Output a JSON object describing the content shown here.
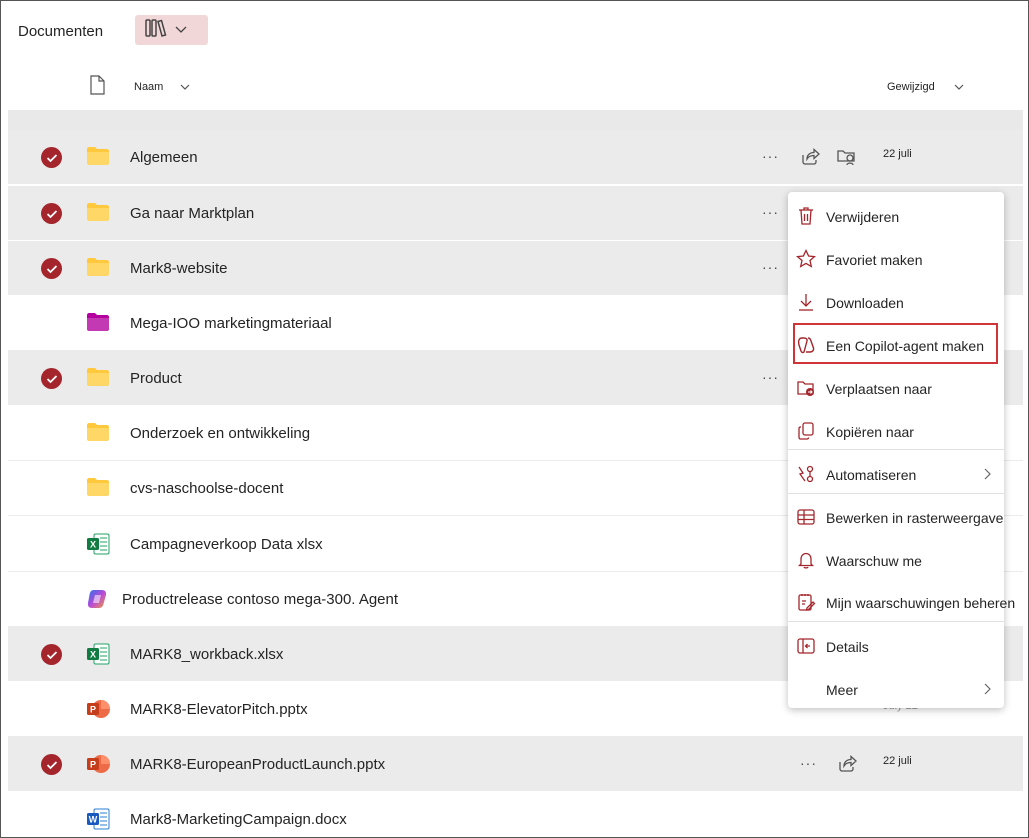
{
  "header": {
    "title": "Documenten",
    "view_icon": "library-icon"
  },
  "columns": {
    "name": "Naam",
    "modified": "Gewijzigd"
  },
  "rows": [
    {
      "name": "Algemeen",
      "type": "folder",
      "selected": true,
      "date": "22 juli"
    },
    {
      "name": "Ga naar Marktplan",
      "type": "folder",
      "selected": true,
      "date": ""
    },
    {
      "name": "Mark8-website",
      "type": "folder",
      "selected": true,
      "date": ""
    },
    {
      "name": "Mega-IOO marketingmateriaal",
      "type": "folder-purple",
      "selected": false,
      "date": ""
    },
    {
      "name": "Product",
      "type": "folder",
      "selected": true,
      "date": ""
    },
    {
      "name": "Onderzoek en ontwikkeling",
      "type": "folder",
      "selected": false,
      "date": ""
    },
    {
      "name": "cvs-naschoolse-docent",
      "type": "folder",
      "selected": false,
      "date": ""
    },
    {
      "name": "Campagneverkoop Data xlsx",
      "type": "excel",
      "selected": false,
      "date": ""
    },
    {
      "name": "Productrelease contoso mega-300. Agent",
      "type": "copilot",
      "selected": false,
      "date": ""
    },
    {
      "name": "MARK8_workback.xlsx",
      "type": "excel",
      "selected": true,
      "date": ""
    },
    {
      "name": "MARK8-ElevatorPitch.pptx",
      "type": "powerpoint",
      "selected": false,
      "date": "July 22"
    },
    {
      "name": "MARK8-EuropeanProductLaunch.pptx",
      "type": "powerpoint",
      "selected": true,
      "date": "22 juli"
    },
    {
      "name": "Mark8-MarketingCampaign.docx",
      "type": "word",
      "selected": false,
      "date": ""
    }
  ],
  "menu": {
    "items": [
      {
        "label": "Verwijderen",
        "icon": "trash-icon"
      },
      {
        "label": "Favoriet maken",
        "icon": "star-icon"
      },
      {
        "label": "Downloaden",
        "icon": "download-icon"
      },
      {
        "label": "Een Copilot-agent maken",
        "icon": "copilot-agent-icon"
      },
      {
        "label": "Verplaatsen naar",
        "icon": "folder-move-icon"
      },
      {
        "label": "Kopiëren naar",
        "icon": "copy-icon"
      },
      {
        "label": "Automatiseren",
        "icon": "automate-icon"
      },
      {
        "label": "Bewerken in rasterweergave",
        "icon": "grid-icon"
      },
      {
        "label": "Waarschuw me",
        "icon": "bell-icon"
      },
      {
        "label": "Mijn waarschuwingen beheren",
        "icon": "manage-alerts-icon"
      },
      {
        "label": "Details",
        "icon": "details-icon"
      },
      {
        "label": "Meer",
        "icon": ""
      }
    ]
  },
  "colors": {
    "accent": "#a4262c",
    "highlight": "#d13438",
    "selected_row": "#ebebeb",
    "folder": "#ffc83d"
  }
}
